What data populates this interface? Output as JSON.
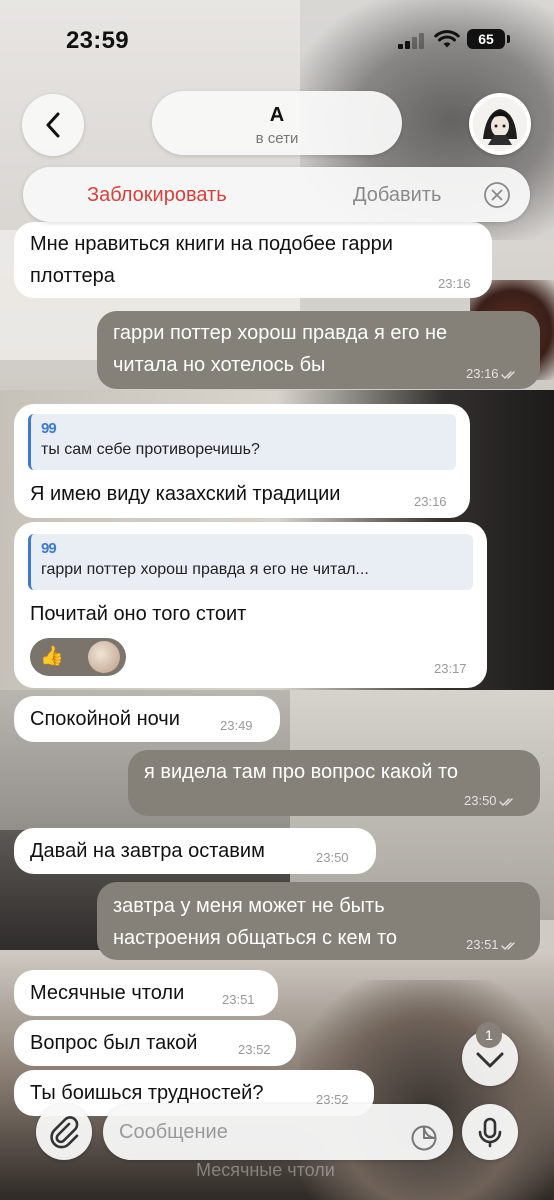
{
  "status_bar": {
    "time": "23:59",
    "battery": "65"
  },
  "header": {
    "back_icon": "chevron-left-icon",
    "name": "А",
    "status": "в сети",
    "avatar_icon": "anime-avatar-icon"
  },
  "action_bar": {
    "block_label": "Заблокировать",
    "add_label": "Добавить",
    "block_color": "#d9403a",
    "close_icon": "close-circle-icon"
  },
  "messages": [
    {
      "direction": "in",
      "lines": [
        "Мне нравиться книги на подобее гарри",
        "плоттера"
      ],
      "time": "23:16"
    },
    {
      "direction": "out",
      "lines": [
        "гарри поттер хорош правда я его не",
        "читала но хотелось бы"
      ],
      "time": "23:16",
      "read": true
    },
    {
      "direction": "in",
      "quote": "ты сам себе противоречишь?",
      "lines": [
        "Я имею виду казахский традиции"
      ],
      "time": "23:16"
    },
    {
      "direction": "in",
      "quote": "гарри поттер хорош правда я его не читал...",
      "lines": [
        "Почитай оно того стоит"
      ],
      "time": "23:17",
      "reaction": "👍"
    },
    {
      "direction": "in",
      "lines": [
        "Спокойной ночи"
      ],
      "time": "23:49"
    },
    {
      "direction": "out",
      "lines": [
        "я видела там про вопрос какой то"
      ],
      "time": "23:50",
      "read": true
    },
    {
      "direction": "in",
      "lines": [
        "Давай на завтра оставим"
      ],
      "time": "23:50"
    },
    {
      "direction": "out",
      "lines": [
        "завтра у меня может не быть",
        "настроения общаться с кем то"
      ],
      "time": "23:51",
      "read": true
    },
    {
      "direction": "in",
      "lines": [
        "Месячные чтоли"
      ],
      "time": "23:51"
    },
    {
      "direction": "in",
      "lines": [
        "Вопрос был такой"
      ],
      "time": "23:52"
    },
    {
      "direction": "in",
      "lines": [
        "Ты боишься трудностей?"
      ],
      "time": "23:52"
    }
  ],
  "scroll_down": {
    "icon": "chevron-down-icon",
    "unread_count": "1"
  },
  "composer": {
    "attach_icon": "paperclip-icon",
    "placeholder": "Сообщение",
    "sticker_icon": "sticker-icon",
    "mic_icon": "microphone-icon",
    "background_preview": "Месячные чтоли"
  },
  "colors": {
    "incoming_bubble": "#ffffff",
    "outgoing_bubble": "#858078",
    "quote_accent": "#3e7bd1"
  }
}
